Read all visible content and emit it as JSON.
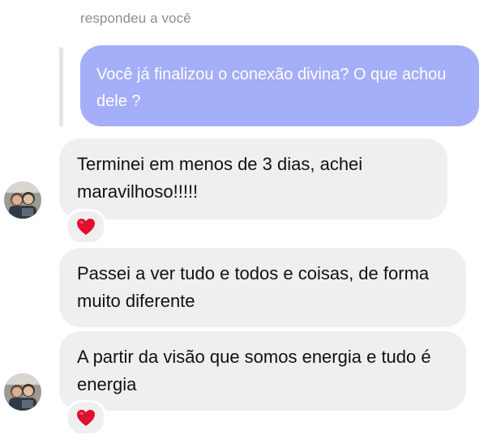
{
  "reply_header": {
    "caption": "respondeu a você"
  },
  "quoted_message": {
    "text": "Você já finalizou o conexão divina? O que achou dele ?",
    "bubble_color": "#a5aef8"
  },
  "messages": [
    {
      "text": "Terminei em menos de 3 dias, achei maravilhoso!!!!!",
      "reaction": "heart-icon",
      "show_avatar": true
    },
    {
      "text": "Passei a ver tudo e todos e coisas, de forma muito diferente",
      "reaction": null,
      "show_avatar": false
    },
    {
      "text": "A partir da visão que somos energia e tudo é energia",
      "reaction": "heart-icon",
      "show_avatar": true
    }
  ],
  "colors": {
    "received_bubble": "#efefef",
    "caption_text": "#8e8e93",
    "reaction_heart": "#e0102e"
  }
}
